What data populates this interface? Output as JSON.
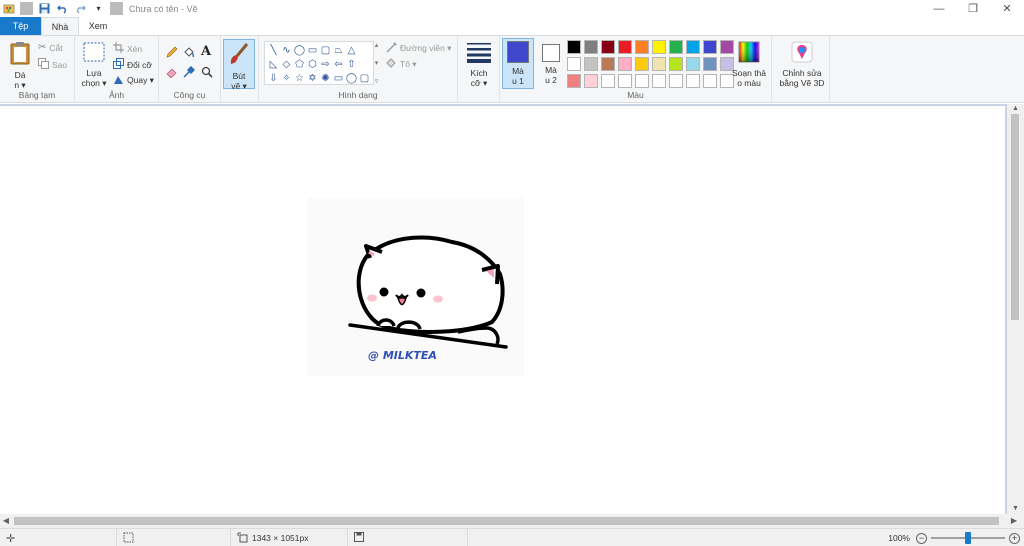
{
  "titlebar": {
    "title": "Chưa có tên - Vẽ",
    "minimize": "—",
    "restore": "❐",
    "close": "✕"
  },
  "tabs": [
    {
      "label": "Tệp"
    },
    {
      "label": "Nhà"
    },
    {
      "label": "Xem"
    }
  ],
  "clipboard": {
    "paste_label": "Dá",
    "paste_label2": "n ▾",
    "cut_label": "Cắt",
    "copy_label": "Sao",
    "group_label": "Bảng tạm"
  },
  "image": {
    "select_label": "Lựa",
    "select_label2": "chọn ▾",
    "crop_label": "Xén",
    "resize_label": "Đổi cỡ",
    "rotate_label": "Quay ▾",
    "group_label": "Ảnh"
  },
  "tools": {
    "group_label": "Công cụ"
  },
  "brushes": {
    "label": "Bút",
    "label2": "vẽ ▾"
  },
  "shapes": {
    "outline_label": "Đường viền ▾",
    "fill_label": "Tô ▾",
    "group_label": "Hình dạng",
    "items": [
      "╲",
      "∿",
      "◯",
      "▭",
      "▢",
      "⏢",
      "△",
      "",
      "◺",
      "◇",
      "⬠",
      "⬡",
      "⇨",
      "⇦",
      "⇧",
      "",
      "⇩",
      "✧",
      "☆",
      "✡",
      "✺",
      "▭",
      "◯",
      "▢"
    ]
  },
  "size": {
    "label": "Kích",
    "label2": "cỡ ▾"
  },
  "colors": {
    "color1_label": "Mà",
    "color1_label2": "u 1",
    "color2_label": "Mà",
    "color2_label2": "u 2",
    "color1_value": "#3f48cc",
    "color2_value": "#ffffff",
    "edit_label": "Soạn thả",
    "edit_label2": "o màu",
    "group_label": "Màu",
    "swatches": [
      "#000000",
      "#7f7f7f",
      "#880015",
      "#ed1c24",
      "#ff7f27",
      "#fff200",
      "#22b14c",
      "#00a2e8",
      "#3f48cc",
      "#a349a4",
      "#ffffff",
      "#c3c3c3",
      "#b97a57",
      "#ffaec9",
      "#ffc90e",
      "#efe4b0",
      "#b5e61d",
      "#99d9ea",
      "#7092be",
      "#c8bfe7",
      "#f08080",
      "#ffd0d8",
      "#ffffff",
      "#ffffff",
      "#ffffff",
      "#ffffff",
      "#ffffff",
      "#ffffff",
      "#ffffff",
      "#ffffff"
    ]
  },
  "paint3d": {
    "label": "Chỉnh sửa",
    "label2": "bằng Vẽ 3D"
  },
  "artwork": {
    "watermark": "@ MILKTEA"
  },
  "statusbar": {
    "dimensions": "1343 × 1051px",
    "zoom": "100%",
    "zoom_level": 0.5
  }
}
